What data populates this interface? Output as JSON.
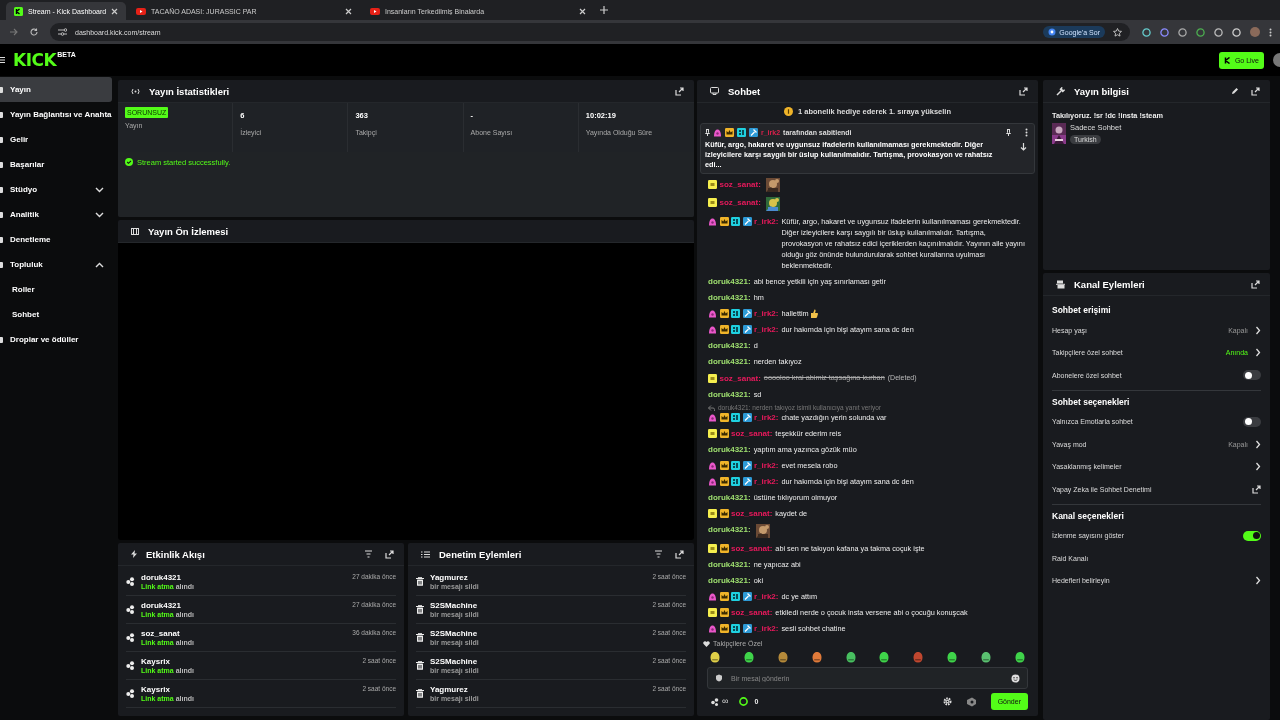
{
  "browser": {
    "tabs": [
      {
        "title": "Stream - Kick Dashboard",
        "selected": true,
        "kind": "kick"
      },
      {
        "title": "TACAÑO ADASI: JURASSIC PAR",
        "selected": false,
        "kind": "video"
      },
      {
        "title": "İnsanların Terkedilmiş Binalarda",
        "selected": false,
        "kind": "video"
      }
    ],
    "url": "dashboard.kick.com/stream",
    "ask_google": "Google'a Sor"
  },
  "header": {
    "logo": "KICK",
    "logo_tag": "BETA",
    "go_live": "Go Live"
  },
  "sidebar": {
    "items": [
      {
        "label": "Yayın",
        "selected": true
      },
      {
        "label": "Yayın Bağlantısı ve Anahta",
        "selected": false
      },
      {
        "label": "Gelir",
        "selected": false
      },
      {
        "label": "Başarılar",
        "selected": false
      },
      {
        "label": "Stüdyo",
        "selected": false,
        "expanded": false
      },
      {
        "label": "Analitik",
        "selected": false,
        "expanded": false
      },
      {
        "label": "Denetleme",
        "selected": false
      },
      {
        "label": "Topluluk",
        "selected": false,
        "expanded": true,
        "children": [
          {
            "label": "Roller",
            "selected": false
          },
          {
            "label": "Sohbet",
            "selected": false
          }
        ]
      },
      {
        "label": "Droplar ve ödüller",
        "selected": false
      }
    ]
  },
  "stats": {
    "title": "Yayın İstatistikleri",
    "health": {
      "badge": "SORUNSUZ",
      "label": "Yayın"
    },
    "items": [
      {
        "value": "6",
        "label": "İzleyici"
      },
      {
        "value": "363",
        "label": "Takipçi"
      },
      {
        "value": "-",
        "label": "Abone Sayısı"
      },
      {
        "value": "10:02:19",
        "label": "Yayında Olduğu Süre"
      }
    ],
    "status": "Stream started successfully."
  },
  "preview": {
    "title": "Yayın Ön İzlemesi"
  },
  "activity": {
    "title": "Etkinlik Akışı",
    "items": [
      {
        "user": "doruk4321",
        "reward": "Link atma",
        "verb": "alındı",
        "time": "27 dakika önce"
      },
      {
        "user": "doruk4321",
        "reward": "Link atma",
        "verb": "alındı",
        "time": "27 dakika önce"
      },
      {
        "user": "soz_sanat",
        "reward": "Link atma",
        "verb": "alındı",
        "time": "36 dakika önce"
      },
      {
        "user": "Kaysrix",
        "reward": "Link atma",
        "verb": "alındı",
        "time": "2 saat önce"
      },
      {
        "user": "Kaysrix",
        "reward": "Link atma",
        "verb": "alındı",
        "time": "2 saat önce"
      }
    ]
  },
  "moderation": {
    "title": "Denetim Eylemleri",
    "items": [
      {
        "user": "Yagmurez",
        "action": "bir mesajı sildi",
        "time": "2 saat önce"
      },
      {
        "user": "S2SMachine",
        "action": "bir mesajı sildi",
        "time": "2 saat önce"
      },
      {
        "user": "S2SMachine",
        "action": "bir mesajı sildi",
        "time": "2 saat önce"
      },
      {
        "user": "S2SMachine",
        "action": "bir mesajı sildi",
        "time": "2 saat önce"
      },
      {
        "user": "Yagmurez",
        "action": "bir mesajı sildi",
        "time": "2 saat önce"
      }
    ]
  },
  "chat": {
    "title": "Sohbet",
    "banner": "1 abonelik hediye ederek 1. sıraya yükselin",
    "pinned": {
      "badges": [
        {
          "kind": "gift"
        },
        {
          "kind": "crown"
        },
        {
          "kind": "og"
        },
        {
          "kind": "mod"
        }
      ],
      "user": "r_irk2",
      "label": "tarafından sabitlendi",
      "text": "Küfür, argo, hakaret ve uygunsuz ifadelerin kullanılmaması gerekmektedir. Diğer izleyicilere karşı saygılı bir üslup kullanılmalıdır. Tartışma, provokasyon ve rahatsız edi..."
    },
    "messages": [
      {
        "kind": "emote",
        "user": "soz_sanat:",
        "color": "#e8195c",
        "badges": [
          {
            "kind": "sub"
          }
        ]
      },
      {
        "kind": "emote",
        "user": "soz_sanat:",
        "color": "#e8195c",
        "badges": [
          {
            "kind": "sub"
          }
        ]
      },
      {
        "kind": "text",
        "user": "r_irk2:",
        "color": "#e8195c",
        "badges": [
          {
            "kind": "gift"
          },
          {
            "kind": "crown"
          },
          {
            "kind": "og"
          },
          {
            "kind": "mod"
          }
        ],
        "text": "Küfür, argo, hakaret ve uygunsuz ifadelerin kullanılmaması gerekmektedir. Diğer izleyicilere karşı saygılı bir üslup kullanılmalıdır. Tartışma, provokasyon ve rahatsız edici içeriklerden kaçınılmalıdır. Yayının aile yayını olduğu göz önünde bulundurularak sohbet kurallarına uyulması beklenmektedir."
      },
      {
        "kind": "text",
        "user": "doruk4321:",
        "color": "#9fe070",
        "text": "abi bence yetkili için yaş sınırlaması getir"
      },
      {
        "kind": "text",
        "user": "doruk4321:",
        "color": "#9fe070",
        "text": "hm"
      },
      {
        "kind": "text",
        "user": "r_irk2:",
        "color": "#e8195c",
        "badges": [
          {
            "kind": "gift"
          },
          {
            "kind": "crown"
          },
          {
            "kind": "og"
          },
          {
            "kind": "mod"
          }
        ],
        "text": "hallettim",
        "emoji": true
      },
      {
        "kind": "text",
        "user": "r_irk2:",
        "color": "#e8195c",
        "badges": [
          {
            "kind": "gift"
          },
          {
            "kind": "crown"
          },
          {
            "kind": "og"
          },
          {
            "kind": "mod"
          }
        ],
        "text": "dur hakımda için bişi atayım sana dc den"
      },
      {
        "kind": "text",
        "user": "doruk4321:",
        "color": "#9fe070",
        "text": "d"
      },
      {
        "kind": "text",
        "user": "doruk4321:",
        "color": "#9fe070",
        "text": "nerden takıyoz"
      },
      {
        "kind": "text",
        "user": "soz_sanat:",
        "color": "#e8195c",
        "badges": [
          {
            "kind": "sub"
          }
        ],
        "text": "ooooloo kral abimiz taşsağına kurban",
        "deleted": true,
        "deleted_label": "(Deleted)"
      },
      {
        "kind": "text",
        "user": "doruk4321:",
        "color": "#9fe070",
        "text": "sd"
      },
      {
        "kind": "text",
        "user": "r_irk2:",
        "color": "#e8195c",
        "badges": [
          {
            "kind": "gift"
          },
          {
            "kind": "crown"
          },
          {
            "kind": "og"
          },
          {
            "kind": "mod"
          }
        ],
        "text": "chate yazdığın yerin solunda var",
        "reply_to": "doruk4321: nerden takıyoz isimli kullanıcıya yanıt veriyor"
      },
      {
        "kind": "text",
        "user": "soz_sanat:",
        "color": "#e8195c",
        "badges": [
          {
            "kind": "sub"
          },
          {
            "kind": "crown"
          }
        ],
        "text": "teşekkür ederim reis"
      },
      {
        "kind": "text",
        "user": "doruk4321:",
        "color": "#9fe070",
        "text": "yaptım ama yazınca gözük müo"
      },
      {
        "kind": "text",
        "user": "r_irk2:",
        "color": "#e8195c",
        "badges": [
          {
            "kind": "gift"
          },
          {
            "kind": "crown"
          },
          {
            "kind": "og"
          },
          {
            "kind": "mod"
          }
        ],
        "text": "evet mesela robo"
      },
      {
        "kind": "text",
        "user": "r_irk2:",
        "color": "#e8195c",
        "badges": [
          {
            "kind": "gift"
          },
          {
            "kind": "crown"
          },
          {
            "kind": "og"
          },
          {
            "kind": "mod"
          }
        ],
        "text": "dur hakımda için bişi atayım sana dc den"
      },
      {
        "kind": "text",
        "user": "doruk4321:",
        "color": "#9fe070",
        "text": "üstüne tıklıyorum olmuyor"
      },
      {
        "kind": "text",
        "user": "soz_sanat:",
        "color": "#e8195c",
        "badges": [
          {
            "kind": "sub"
          },
          {
            "kind": "crown"
          }
        ],
        "text": "kaydet de"
      },
      {
        "kind": "emote",
        "user": "doruk4321:",
        "color": "#9fe070"
      },
      {
        "kind": "text",
        "user": "soz_sanat:",
        "color": "#e8195c",
        "badges": [
          {
            "kind": "sub"
          },
          {
            "kind": "crown"
          }
        ],
        "text": "abi sen ne takıyon kafana ya takma coçuk işte"
      },
      {
        "kind": "text",
        "user": "doruk4321:",
        "color": "#9fe070",
        "text": "ne yapıcaz abi"
      },
      {
        "kind": "text",
        "user": "doruk4321:",
        "color": "#9fe070",
        "text": "oki"
      },
      {
        "kind": "text",
        "user": "r_irk2:",
        "color": "#e8195c",
        "badges": [
          {
            "kind": "gift"
          },
          {
            "kind": "crown"
          },
          {
            "kind": "og"
          },
          {
            "kind": "mod"
          }
        ],
        "text": "dc ye attım"
      },
      {
        "kind": "text",
        "user": "soz_sanat:",
        "color": "#e8195c",
        "badges": [
          {
            "kind": "sub"
          },
          {
            "kind": "crown"
          }
        ],
        "text": "etkiledi nerde o çocuk insta versene abi o çocuğu konuşcak"
      },
      {
        "kind": "text",
        "user": "r_irk2:",
        "color": "#e8195c",
        "badges": [
          {
            "kind": "gift"
          },
          {
            "kind": "crown"
          },
          {
            "kind": "og"
          },
          {
            "kind": "mod"
          }
        ],
        "text": "sesli sohbet chatine"
      }
    ],
    "followers_only": "Takipçilere Özel",
    "placeholder": "Bir mesaj gönderin",
    "infinity": "∞",
    "points": "0",
    "send": "Gönder"
  },
  "stream_info": {
    "title": "Yayın bilgisi",
    "stream_title": "Takılıyoruz. !sr !dc !insta !steam",
    "category": "Sadece Sohbet",
    "tag": "Turkish"
  },
  "channel_actions": {
    "title": "Kanal Eylemleri",
    "sections": [
      {
        "title": "Sohbet erişimi",
        "rows": [
          {
            "kind": "select",
            "label": "Hesap yaşı",
            "value": "Kapalı",
            "active": false
          },
          {
            "kind": "select",
            "label": "Takipçilere özel sohbet",
            "value": "Anında",
            "active": true
          },
          {
            "kind": "toggle",
            "label": "Abonelere özel sohbet",
            "on": false
          }
        ]
      },
      {
        "title": "Sohbet seçenekleri",
        "rows": [
          {
            "kind": "toggle",
            "label": "Yalnızca Emotlarla sohbet",
            "on": false
          },
          {
            "kind": "select",
            "label": "Yavaş mod",
            "value": "Kapalı",
            "active": false
          },
          {
            "kind": "link",
            "label": "Yasaklanmış kelimeler"
          },
          {
            "kind": "external",
            "label": "Yapay Zeka ile Sohbet Denetimi"
          }
        ]
      },
      {
        "title": "Kanal seçenekleri",
        "rows": [
          {
            "kind": "toggle",
            "label": "İzlenme sayısını göster",
            "on": true
          },
          {
            "kind": "plain",
            "label": "Raid Kanalı"
          },
          {
            "kind": "link",
            "label": "Hedefleri belirleyin"
          }
        ]
      }
    ]
  }
}
